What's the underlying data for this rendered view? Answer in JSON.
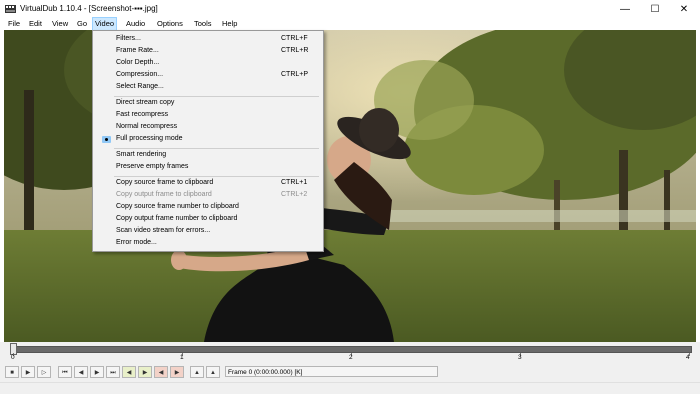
{
  "window": {
    "title": "VirtualDub 1.10.4 - [Screenshot-▪▪▪.jpg]",
    "minimize_glyph": "—",
    "maximize_glyph": "☐",
    "close_glyph": "✕"
  },
  "menubar": {
    "items": [
      "File",
      "Edit",
      "View",
      "Go",
      "Video",
      "Audio",
      "Options",
      "Tools",
      "Help"
    ],
    "active": "Video"
  },
  "video_menu": {
    "items": [
      {
        "label": "Filters...",
        "shortcut": "CTRL+F"
      },
      {
        "label": "Frame Rate...",
        "shortcut": "CTRL+R"
      },
      {
        "label": "Color Depth...",
        "shortcut": ""
      },
      {
        "label": "Compression...",
        "shortcut": "CTRL+P"
      },
      {
        "label": "Select Range...",
        "shortcut": ""
      },
      {
        "label": "Direct stream copy",
        "shortcut": ""
      },
      {
        "label": "Fast recompress",
        "shortcut": ""
      },
      {
        "label": "Normal recompress",
        "shortcut": ""
      },
      {
        "label": "Full processing mode",
        "shortcut": "",
        "checked": true
      },
      {
        "label": "Smart rendering",
        "shortcut": ""
      },
      {
        "label": "Preserve empty frames",
        "shortcut": ""
      },
      {
        "label": "Copy source frame to clipboard",
        "shortcut": "CTRL+1"
      },
      {
        "label": "Copy output frame to clipboard",
        "shortcut": "CTRL+2",
        "disabled": true
      },
      {
        "label": "Copy source frame number to clipboard",
        "shortcut": ""
      },
      {
        "label": "Copy output frame number to clipboard",
        "shortcut": ""
      },
      {
        "label": "Scan video stream for errors...",
        "shortcut": ""
      },
      {
        "label": "Error mode...",
        "shortcut": ""
      }
    ]
  },
  "timeline": {
    "tick_labels": [
      "0",
      "1",
      "2",
      "3",
      "4"
    ],
    "position": 0
  },
  "toolbar": {
    "frame_readout": "Frame 0 (0:00:00.000) [K]"
  },
  "colors": {
    "menu_highlight": "#cce8ff",
    "check_mark_bg": "#90c8f6",
    "track": "#6a6a6a"
  }
}
